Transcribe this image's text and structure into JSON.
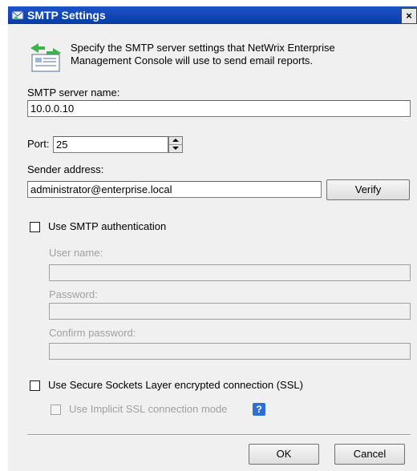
{
  "window": {
    "title": "SMTP Settings",
    "close_glyph": "×"
  },
  "header": {
    "description": "Specify the SMTP server settings that NetWrix Enterprise Management Console will use to send email reports.",
    "icon": "mail-settings-icon"
  },
  "form": {
    "smtp_server_label": "SMTP server name:",
    "smtp_server_value": "10.0.0.10",
    "port_label": "Port:",
    "port_value": "25",
    "sender_label": "Sender address:",
    "sender_value": "administrator@enterprise.local",
    "verify_button": "Verify",
    "use_auth_label": "Use SMTP authentication",
    "use_auth_checked": false,
    "username_label": "User name:",
    "username_value": "",
    "password_label": "Password:",
    "password_value": "",
    "confirm_password_label": "Confirm password:",
    "confirm_password_value": "",
    "use_ssl_label": "Use Secure Sockets Layer encrypted connection (SSL)",
    "use_ssl_checked": false,
    "implicit_ssl_label": "Use Implicit SSL connection mode",
    "implicit_ssl_checked": false,
    "help_glyph": "?"
  },
  "footer": {
    "ok_button": "OK",
    "cancel_button": "Cancel"
  }
}
